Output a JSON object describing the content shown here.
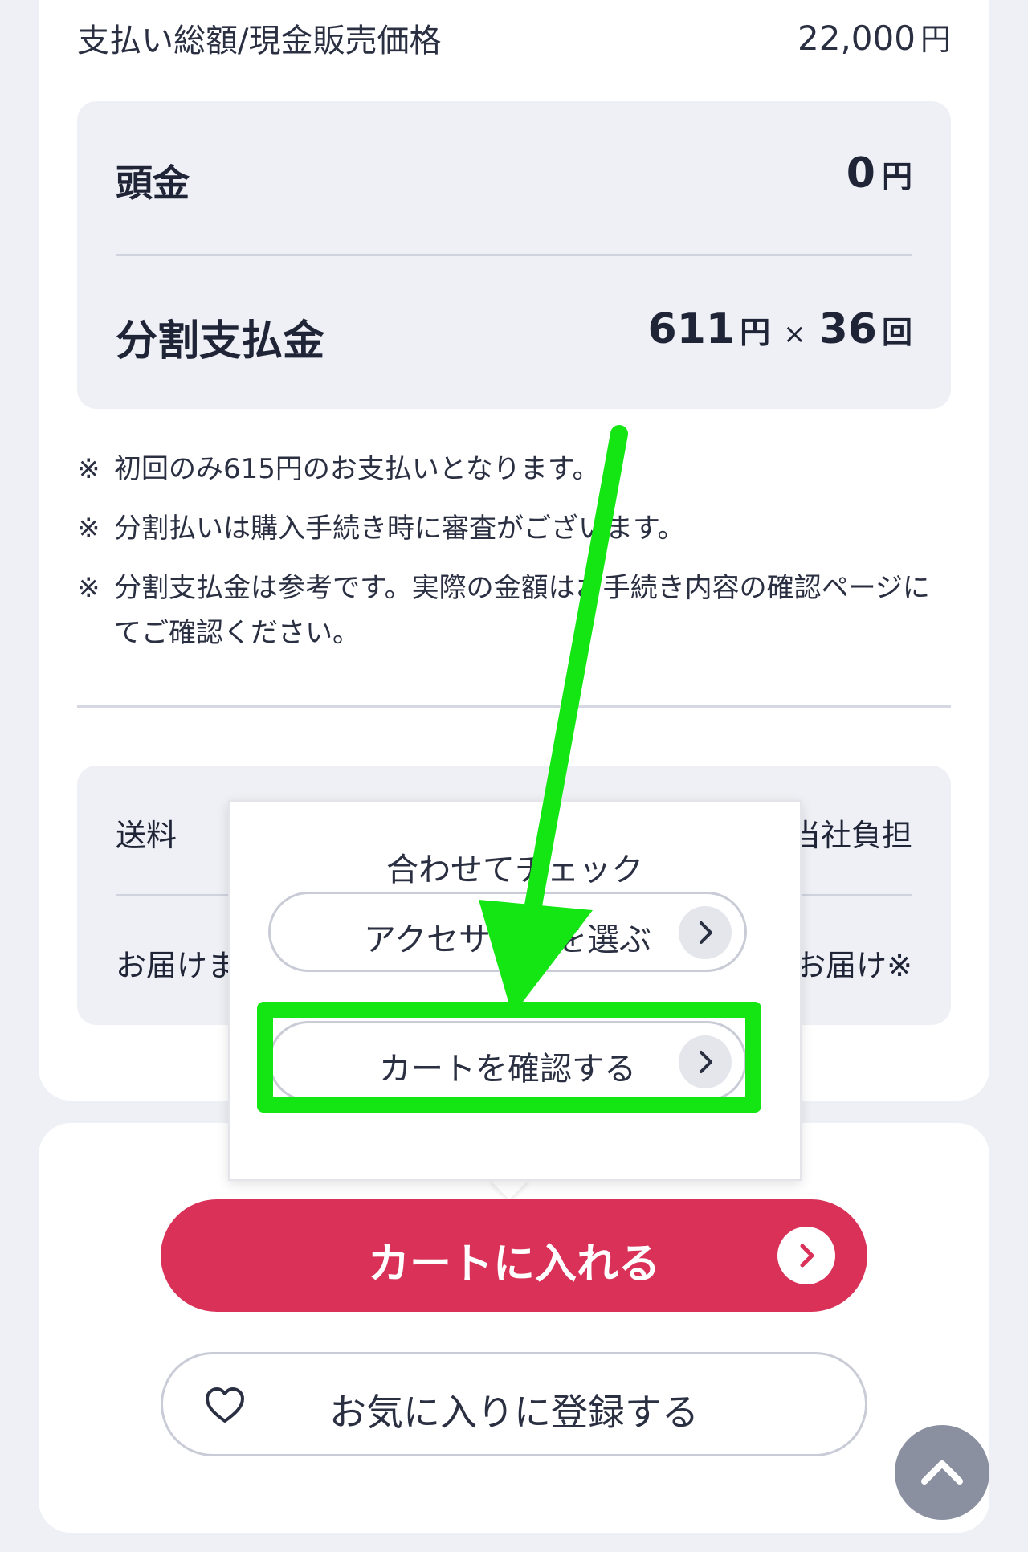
{
  "summary": {
    "total_label": "支払い総額/現金販売価格",
    "total_value": "22,000",
    "total_unit": "円"
  },
  "payment": {
    "down_label": "頭金",
    "down_value": "0",
    "down_unit": "円",
    "installment_label": "分割支払金",
    "installment_value": "611",
    "installment_unit": "円",
    "times_symbol": "×",
    "installment_count": "36",
    "count_unit": "回"
  },
  "notes": {
    "mark": "※",
    "items": [
      "初回のみ615円のお支払いとなります。",
      "分割払いは購入手続き時に審査がございます。",
      "分割支払金は参考です。実際の金額はお手続き内容の確認ページにてご確認ください。"
    ]
  },
  "shipping": {
    "fee_label": "送料",
    "fee_value": "当社負担",
    "delivery_label": "お届けまで",
    "delivery_value": "お届け※"
  },
  "popup": {
    "title": "合わせてチェック",
    "accessory_button": "アクセサリーを選ぶ",
    "cart_check_button": "カートを確認する"
  },
  "actions": {
    "add_to_cart": "カートに入れる",
    "favorite": "お気に入りに登録する"
  },
  "colors": {
    "primary": "#d93158",
    "highlight": "#14e614",
    "panel": "#eef0f5"
  },
  "icons": [
    "chevron-right-icon",
    "heart-icon",
    "chevron-up-icon",
    "annotation-arrow"
  ]
}
